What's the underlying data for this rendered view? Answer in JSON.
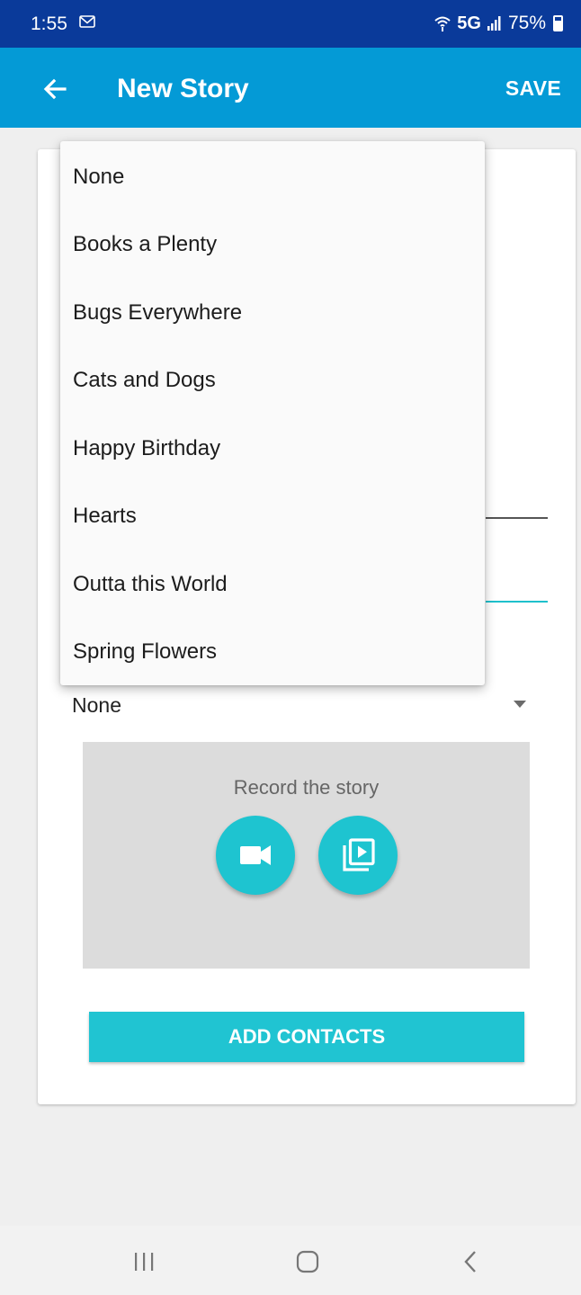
{
  "status_bar": {
    "time": "1:55",
    "network": "5G",
    "battery": "75%",
    "icons": [
      "mail-icon",
      "wifi-calling-icon",
      "signal-icon",
      "battery-icon"
    ]
  },
  "app_bar": {
    "title": "New Story",
    "save_label": "SAVE",
    "back_icon": "arrow-left-icon"
  },
  "dropdown": {
    "options": [
      "None",
      "Books a Plenty",
      "Bugs Everywhere",
      "Cats and Dogs",
      "Happy Birthday",
      "Hearts",
      "Outta this World",
      "Spring Flowers"
    ]
  },
  "theme_select": {
    "value": "None"
  },
  "record": {
    "label": "Record the story",
    "buttons": [
      "video-camera-icon",
      "video-library-icon"
    ]
  },
  "add_contacts_label": "ADD CONTACTS",
  "colors": {
    "status_bar": "#0a3a9a",
    "app_bar": "#049ad6",
    "accent": "#1ec4d0",
    "card": "#ffffff",
    "background": "#efefef",
    "record_panel": "#dcdcdc"
  },
  "nav_bar": {
    "icons": [
      "recents-icon",
      "home-icon",
      "back-chevron-icon"
    ]
  }
}
